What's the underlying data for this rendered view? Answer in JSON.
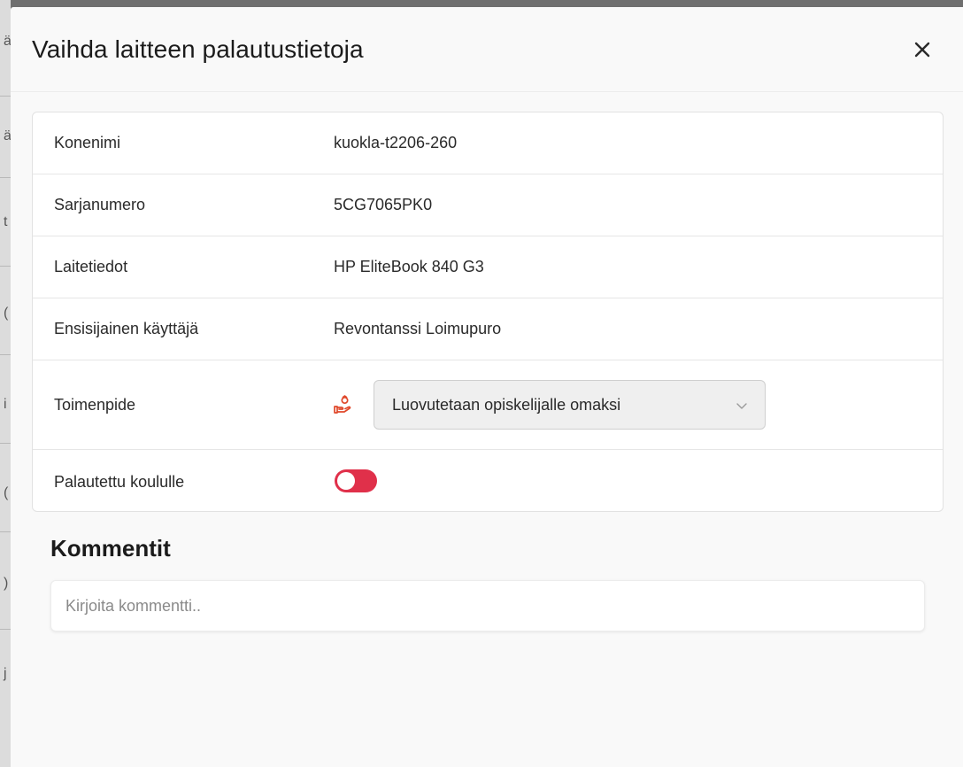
{
  "modal": {
    "title": "Vaihda laitteen palautustietoja",
    "close_icon": "close-icon"
  },
  "device": {
    "rows": [
      {
        "label": "Konenimi",
        "value": "kuokla-t2206-260"
      },
      {
        "label": "Sarjanumero",
        "value": "5CG7065PK0"
      },
      {
        "label": "Laitetiedot",
        "value": "HP EliteBook 840 G3"
      },
      {
        "label": "Ensisijainen käyttäjä",
        "value": "Revontanssi Loimupuro"
      }
    ],
    "action": {
      "label": "Toimenpide",
      "icon": "hand-giving-icon",
      "icon_color": "#e0482a",
      "selected": "Luovutetaan opiskelijalle omaksi"
    },
    "returned": {
      "label": "Palautettu koululle",
      "toggle_on": false,
      "toggle_color": "#e0304a"
    }
  },
  "comments": {
    "title": "Kommentit",
    "placeholder": "Kirjoita kommentti.."
  }
}
